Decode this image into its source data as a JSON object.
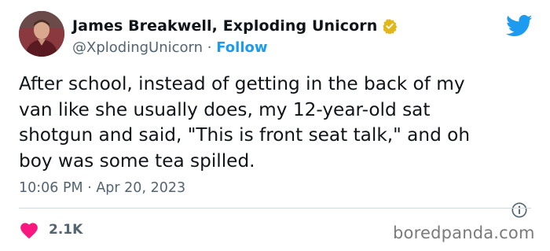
{
  "author": {
    "display_name": "James Breakwell, Exploding Unicorn",
    "handle": "@XplodingUnicorn",
    "separator": "·",
    "follow_label": "Follow",
    "avatar_icon": "avatar-photo",
    "verified_icon": "verified-badge-icon",
    "verified_color": "#e2b719"
  },
  "brand": {
    "logo_icon": "twitter-bird-icon",
    "color": "#1d9bf0"
  },
  "tweet": {
    "lines": [
      "After school, instead of getting in the back of my",
      "van like she usually does, my 12-year-old sat",
      "shotgun and said, \"This is front seat talk,\" and oh",
      "boy was some tea spilled."
    ],
    "timestamp": "10:06 PM · Apr 20, 2023",
    "info_icon": "info-icon"
  },
  "engagement": {
    "heart_icon": "heart-icon",
    "heart_color": "#f91880",
    "like_count": "2.1K"
  },
  "watermark": {
    "text": "boredpanda.com"
  }
}
